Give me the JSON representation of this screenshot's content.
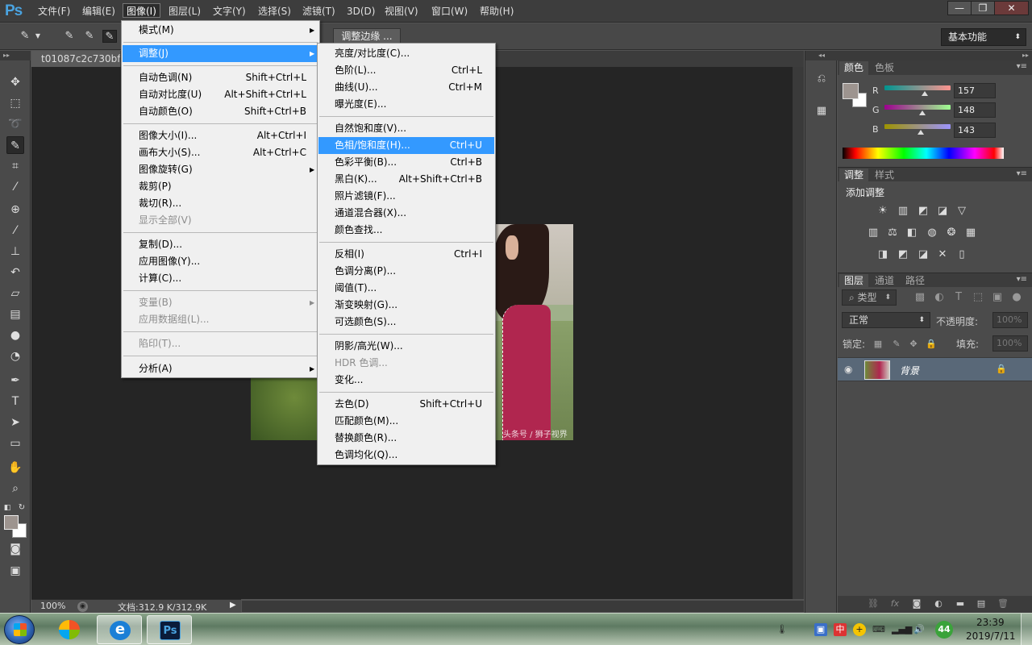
{
  "app": {
    "logo": "Ps"
  },
  "menubar": {
    "items": [
      "文件(F)",
      "编辑(E)",
      "图像(I)",
      "图层(L)",
      "文字(Y)",
      "选择(S)",
      "滤镜(T)",
      "3D(D)",
      "视图(V)",
      "窗口(W)",
      "帮助(H)"
    ],
    "active_index": 2
  },
  "window_controls": {
    "minimize": "—",
    "restore": "❐",
    "close": "✕"
  },
  "options_bar": {
    "refine_edge_label": "调整边缘 ...",
    "workspace": "基本功能"
  },
  "document": {
    "tab_title": "t01087c2c730bf3",
    "zoom": "100%",
    "doc_size": "文档:312.9 K/312.9K",
    "watermark": "头条号 / 狮子视界"
  },
  "image_menu": {
    "items": [
      {
        "label": "模式(M)",
        "shortcut": "",
        "submenu": true,
        "disabled": false
      },
      {
        "label": "调整(J)",
        "shortcut": "",
        "submenu": true,
        "disabled": false,
        "highlight": true
      },
      {
        "label": "自动色调(N)",
        "shortcut": "Shift+Ctrl+L",
        "submenu": false,
        "disabled": false
      },
      {
        "label": "自动对比度(U)",
        "shortcut": "Alt+Shift+Ctrl+L",
        "submenu": false,
        "disabled": false
      },
      {
        "label": "自动颜色(O)",
        "shortcut": "Shift+Ctrl+B",
        "submenu": false,
        "disabled": false
      },
      {
        "label": "图像大小(I)...",
        "shortcut": "Alt+Ctrl+I",
        "submenu": false,
        "disabled": false
      },
      {
        "label": "画布大小(S)...",
        "shortcut": "Alt+Ctrl+C",
        "submenu": false,
        "disabled": false
      },
      {
        "label": "图像旋转(G)",
        "shortcut": "",
        "submenu": true,
        "disabled": false
      },
      {
        "label": "裁剪(P)",
        "shortcut": "",
        "submenu": false,
        "disabled": false
      },
      {
        "label": "裁切(R)...",
        "shortcut": "",
        "submenu": false,
        "disabled": false
      },
      {
        "label": "显示全部(V)",
        "shortcut": "",
        "submenu": false,
        "disabled": true
      },
      {
        "label": "复制(D)...",
        "shortcut": "",
        "submenu": false,
        "disabled": false
      },
      {
        "label": "应用图像(Y)...",
        "shortcut": "",
        "submenu": false,
        "disabled": false
      },
      {
        "label": "计算(C)...",
        "shortcut": "",
        "submenu": false,
        "disabled": false
      },
      {
        "label": "变量(B)",
        "shortcut": "",
        "submenu": true,
        "disabled": true
      },
      {
        "label": "应用数据组(L)...",
        "shortcut": "",
        "submenu": false,
        "disabled": true
      },
      {
        "label": "陷印(T)...",
        "shortcut": "",
        "submenu": false,
        "disabled": true
      },
      {
        "label": "分析(A)",
        "shortcut": "",
        "submenu": true,
        "disabled": false
      }
    ]
  },
  "adjust_menu": {
    "items": [
      {
        "label": "亮度/对比度(C)...",
        "shortcut": "",
        "disabled": false
      },
      {
        "label": "色阶(L)...",
        "shortcut": "Ctrl+L",
        "disabled": false
      },
      {
        "label": "曲线(U)...",
        "shortcut": "Ctrl+M",
        "disabled": false
      },
      {
        "label": "曝光度(E)...",
        "shortcut": "",
        "disabled": false
      },
      {
        "label": "自然饱和度(V)...",
        "shortcut": "",
        "disabled": false
      },
      {
        "label": "色相/饱和度(H)...",
        "shortcut": "Ctrl+U",
        "disabled": false,
        "highlight": true
      },
      {
        "label": "色彩平衡(B)...",
        "shortcut": "Ctrl+B",
        "disabled": false
      },
      {
        "label": "黑白(K)...",
        "shortcut": "Alt+Shift+Ctrl+B",
        "disabled": false
      },
      {
        "label": "照片滤镜(F)...",
        "shortcut": "",
        "disabled": false
      },
      {
        "label": "通道混合器(X)...",
        "shortcut": "",
        "disabled": false
      },
      {
        "label": "颜色查找...",
        "shortcut": "",
        "disabled": false
      },
      {
        "label": "反相(I)",
        "shortcut": "Ctrl+I",
        "disabled": false
      },
      {
        "label": "色调分离(P)...",
        "shortcut": "",
        "disabled": false
      },
      {
        "label": "阈值(T)...",
        "shortcut": "",
        "disabled": false
      },
      {
        "label": "渐变映射(G)...",
        "shortcut": "",
        "disabled": false
      },
      {
        "label": "可选颜色(S)...",
        "shortcut": "",
        "disabled": false
      },
      {
        "label": "阴影/高光(W)...",
        "shortcut": "",
        "disabled": false
      },
      {
        "label": "HDR 色调...",
        "shortcut": "",
        "disabled": true
      },
      {
        "label": "变化...",
        "shortcut": "",
        "disabled": false
      },
      {
        "label": "去色(D)",
        "shortcut": "Shift+Ctrl+U",
        "disabled": false
      },
      {
        "label": "匹配颜色(M)...",
        "shortcut": "",
        "disabled": false
      },
      {
        "label": "替换颜色(R)...",
        "shortcut": "",
        "disabled": false
      },
      {
        "label": "色调均化(Q)...",
        "shortcut": "",
        "disabled": false
      }
    ]
  },
  "color_panel": {
    "tabs": [
      "颜色",
      "色板"
    ],
    "r_label": "R",
    "g_label": "G",
    "b_label": "B",
    "r": "157",
    "g": "148",
    "b": "143",
    "foreground_color": "#9d948f"
  },
  "adjustments_panel": {
    "tabs": [
      "调整",
      "样式"
    ],
    "title": "添加调整"
  },
  "layers_panel": {
    "tabs": [
      "图层",
      "通道",
      "路径"
    ],
    "filter_kind": "类型",
    "blend_mode": "正常",
    "opacity_label": "不透明度:",
    "opacity_value": "100%",
    "lock_label": "锁定:",
    "fill_label": "填充:",
    "fill_value": "100%",
    "layer_name": "背景"
  },
  "taskbar": {
    "time": "23:39",
    "date": "2019/7/11",
    "badge": "44",
    "photoshop_label": "Ps",
    "ie_label": "e"
  }
}
